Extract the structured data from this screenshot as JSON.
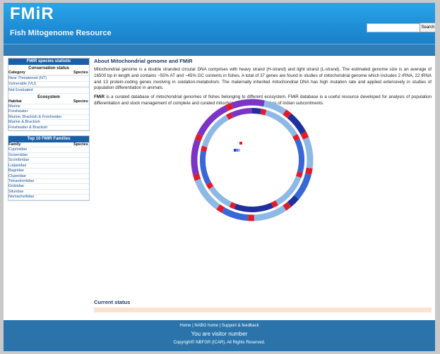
{
  "header": {
    "logo": "FMiR",
    "subtitle": "Fish Mitogenome Resource",
    "search_placeholder": "",
    "search_button": "Search"
  },
  "nav": [
    "",
    "",
    "",
    "",
    ""
  ],
  "species_stats": {
    "title": "FMIR species statistic",
    "conservation": {
      "title": "Conservation status",
      "col_category": "Category",
      "col_species": "Species",
      "rows": [
        {
          "name": "",
          "value": ""
        },
        {
          "name": "Near Threatened (NT)",
          "value": ""
        },
        {
          "name": "Vulnerable (VU)",
          "value": ""
        },
        {
          "name": "",
          "value": ""
        },
        {
          "name": "",
          "value": ""
        },
        {
          "name": "Not Evaluated",
          "value": ""
        }
      ]
    },
    "ecosystem": {
      "title": "Ecosystem",
      "col_habitat": "Habitat",
      "col_species": "Species",
      "rows": [
        {
          "name": "Marine",
          "value": ""
        },
        {
          "name": "Freshwater",
          "value": ""
        },
        {
          "name": "Marine, Brackish & Freshwater",
          "value": ""
        },
        {
          "name": "Marine & Brackish",
          "value": ""
        },
        {
          "name": "Freshwater & Brackish",
          "value": ""
        }
      ]
    }
  },
  "families": {
    "title": "Top 10 FMIR Families",
    "col_family": "Family",
    "col_species": "Species",
    "rows": [
      {
        "name": "Cyprinidae",
        "value": ""
      },
      {
        "name": "Sciaenidae",
        "value": ""
      },
      {
        "name": "Scombridae",
        "value": ""
      },
      {
        "name": "Lutjanidae",
        "value": ""
      },
      {
        "name": "Bagridae",
        "value": ""
      },
      {
        "name": "Clupeidae",
        "value": ""
      },
      {
        "name": "Tetraodontidae",
        "value": ""
      },
      {
        "name": "Gobiidae",
        "value": ""
      },
      {
        "name": "Siluridae",
        "value": ""
      },
      {
        "name": "Nemacheilidae",
        "value": ""
      }
    ]
  },
  "main": {
    "title": "About Mitochondrial genome and FMiR",
    "para1": "Mitochondrial genome is a double stranded circular DNA comprises with heavy strand (H-strand) and light strand (L-strand). The estimated genome size is an average of 16500 bp in length and contains ~55% AT and ~45% GC contents in fishes. A total of 37 genes are found in studies of mitochondrial genome which includes 2 rRNA, 22 tRNA and 13 protein-coding genes involving in oxidation-metabolism. The maternally inherited mitochondrial DNA has high mutation rate and applied extensively in studies of population differentiation in animals.",
    "para2_bold": "FMiR",
    "para2_rest": " is a curated database of mitochondrial genomes of fishes belonging to different ecosystem. FMiR database is a useful resource developed for analysis of population differentiation and stock management of complete and curated mitochondrial genome of fishes of Indian subcontinents."
  },
  "diagram": {
    "labels": {
      "control": "",
      "rrna16s": "",
      "rrna12s": "",
      "cytb": "",
      "nadh_top": "",
      "nadh_left": "",
      "nadh_right": "",
      "cox3": "",
      "atp": "",
      "cox1": ""
    },
    "legend": [
      {
        "label": "",
        "color": "#e21b2a"
      },
      {
        "label": "",
        "color": "#2a3bd1"
      }
    ],
    "colors": {
      "light": "#8db9e6",
      "mid": "#3a67d6",
      "dark": "#1f2f9e",
      "purple": "#7b35c5",
      "red": "#e21b2a"
    }
  },
  "status": {
    "title": "Current status"
  },
  "footer": {
    "link_home": "Home",
    "link_nabg": "NABG home",
    "link_support": "Support & feedback",
    "visitor_label": "You are visitor number",
    "visitor_count": "",
    "copyright": "Copyright© NBFGR (ICAR). All Rights Reserved."
  }
}
